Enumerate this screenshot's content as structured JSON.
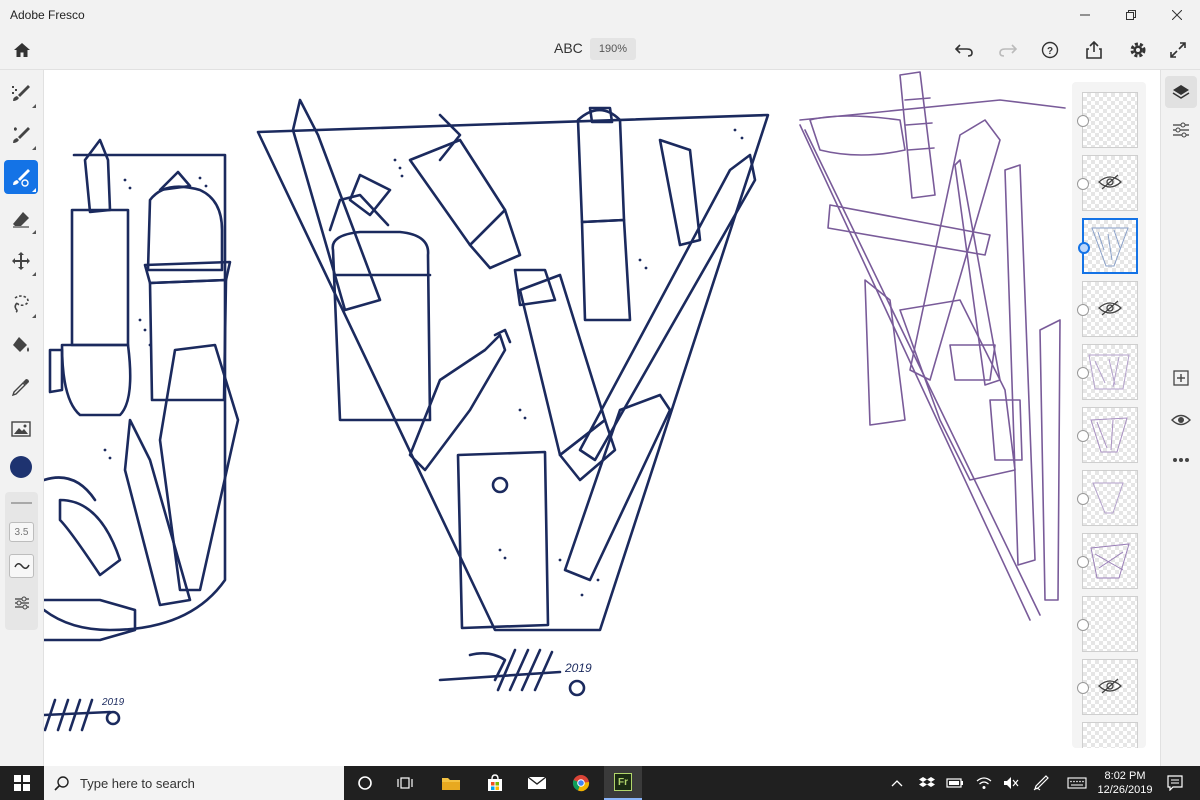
{
  "window": {
    "title": "Adobe Fresco"
  },
  "header": {
    "doc_title": "ABC",
    "zoom": "190%"
  },
  "tools": [
    {
      "name": "pixel-brush",
      "icon": "pixel-brush-icon"
    },
    {
      "name": "live-brush",
      "icon": "live-brush-icon"
    },
    {
      "name": "vector-brush",
      "icon": "vector-brush-icon",
      "active": true
    },
    {
      "name": "eraser",
      "icon": "eraser-icon"
    },
    {
      "name": "move-transform",
      "icon": "move-icon"
    },
    {
      "name": "lasso",
      "icon": "lasso-icon"
    },
    {
      "name": "fill",
      "icon": "paint-bucket-icon"
    },
    {
      "name": "eyedropper",
      "icon": "eyedropper-icon"
    },
    {
      "name": "place-image",
      "icon": "image-icon"
    }
  ],
  "brush": {
    "current_color": "#1e3370",
    "size": "3.5"
  },
  "colors": {
    "ink": "#1b2a5e",
    "sketch": "#6b4a8f",
    "accent": "#1473e6"
  },
  "layers": [
    {
      "hidden": false,
      "active": false
    },
    {
      "hidden": true,
      "active": false
    },
    {
      "hidden": false,
      "active": true
    },
    {
      "hidden": true,
      "active": false
    },
    {
      "hidden": false,
      "active": false
    },
    {
      "hidden": false,
      "active": false
    },
    {
      "hidden": false,
      "active": false
    },
    {
      "hidden": false,
      "active": false
    },
    {
      "hidden": false,
      "active": false
    },
    {
      "hidden": true,
      "active": false
    }
  ],
  "taskbar": {
    "search_placeholder": "Type here to search",
    "time": "8:02 PM",
    "date": "12/26/2019",
    "fresco_label": "Fr"
  },
  "artwork": {
    "signature_year": "2019"
  }
}
